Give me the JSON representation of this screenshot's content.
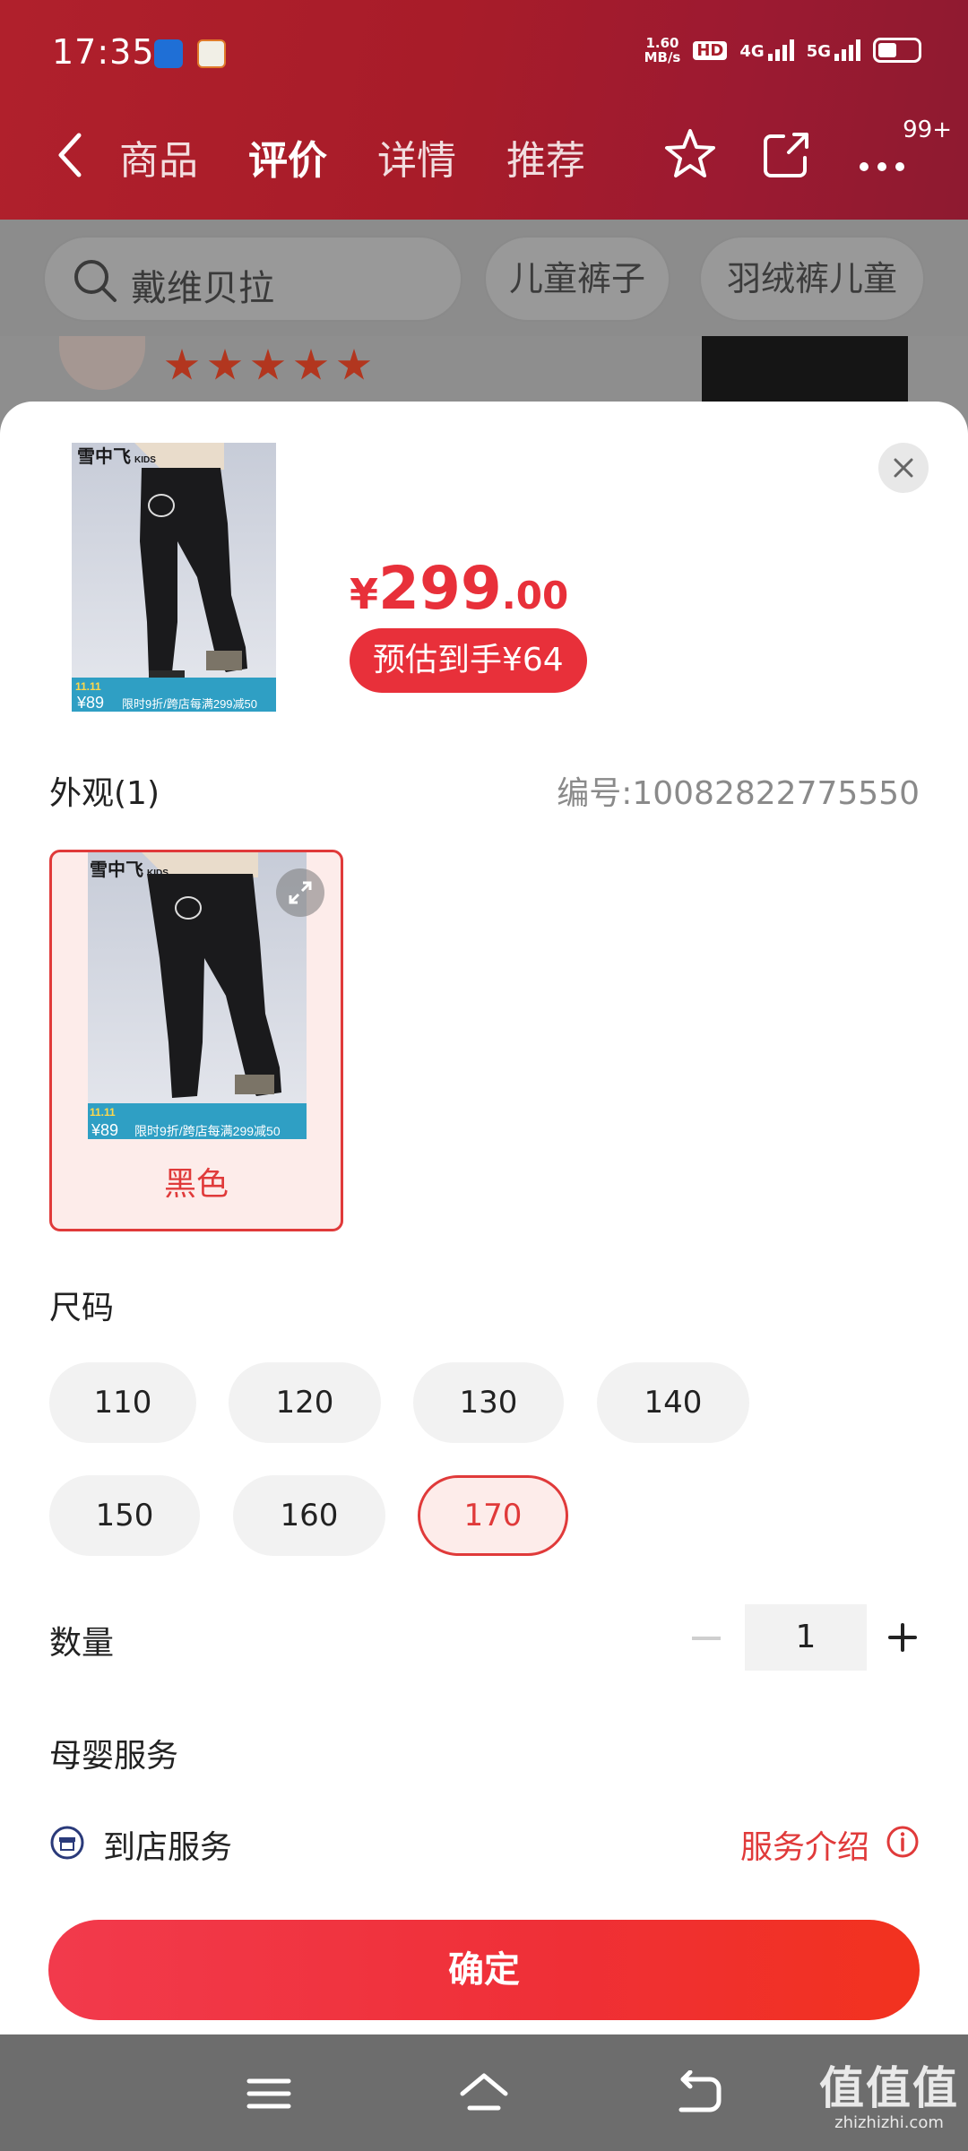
{
  "status_bar": {
    "time": "17:35",
    "net_speed_value": "1.60",
    "net_speed_unit": "MB/s",
    "hd_label": "HD",
    "network_1": "4G",
    "network_2": "5G"
  },
  "nav": {
    "tabs": [
      "商品",
      "评价",
      "详情",
      "推荐"
    ],
    "active_tab_index": 1,
    "badge": "99+"
  },
  "search": {
    "query": "戴维贝拉",
    "chips": [
      "儿童裤子",
      "羽绒裤儿童"
    ]
  },
  "sheet": {
    "price_currency": "¥",
    "price_integer": "299",
    "price_decimal": ".00",
    "estimate_label": "预估到手¥64",
    "appearance_label": "外观(1)",
    "sku_label": "编号:10082822775550",
    "color_option": "黑色",
    "size_label": "尺码",
    "sizes": [
      "110",
      "120",
      "130",
      "140",
      "150",
      "160",
      "170"
    ],
    "selected_size": "170",
    "quantity_label": "数量",
    "quantity_value": "1",
    "maternity_label": "母婴服务",
    "store_service_label": "到店服务",
    "service_intro_link": "服务介绍",
    "confirm_label": "确定"
  },
  "product_image": {
    "brand_text": "雪中飞KIDS",
    "promo_price": "¥89",
    "promo_text": "限时9折/跨店每满299减50",
    "event_tag": "11.11"
  },
  "watermark": {
    "text": "值值值",
    "domain": "zhizhizhi.com"
  },
  "colors": {
    "accent": "#e8303a",
    "header_red": "#a81c29",
    "selected_bg": "#fdecea"
  },
  "icons": [
    "back-icon",
    "star-icon",
    "share-icon",
    "more-icon",
    "search-icon",
    "close-icon",
    "expand-icon",
    "plus-icon",
    "minus-icon",
    "store-icon",
    "info-icon",
    "menu-icon",
    "home-icon",
    "return-icon"
  ]
}
